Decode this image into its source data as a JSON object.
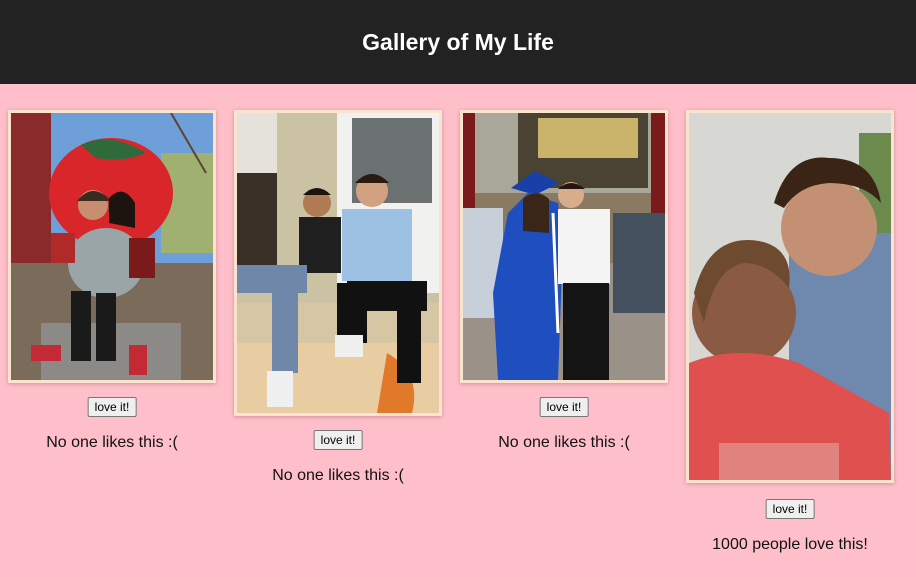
{
  "header": {
    "title": "Gallery of My Life"
  },
  "gallery": {
    "items": [
      {
        "button_label": "love it!",
        "likes_text": "No one likes this :("
      },
      {
        "button_label": "love it!",
        "likes_text": "No one likes this :("
      },
      {
        "button_label": "love it!",
        "likes_text": "No one likes this :("
      },
      {
        "button_label": "love it!",
        "likes_text": "1000 people love this!"
      }
    ]
  },
  "colors": {
    "page_background": "#ffbfca",
    "header_background": "#222222",
    "photo_border": "#fbe3cf"
  }
}
